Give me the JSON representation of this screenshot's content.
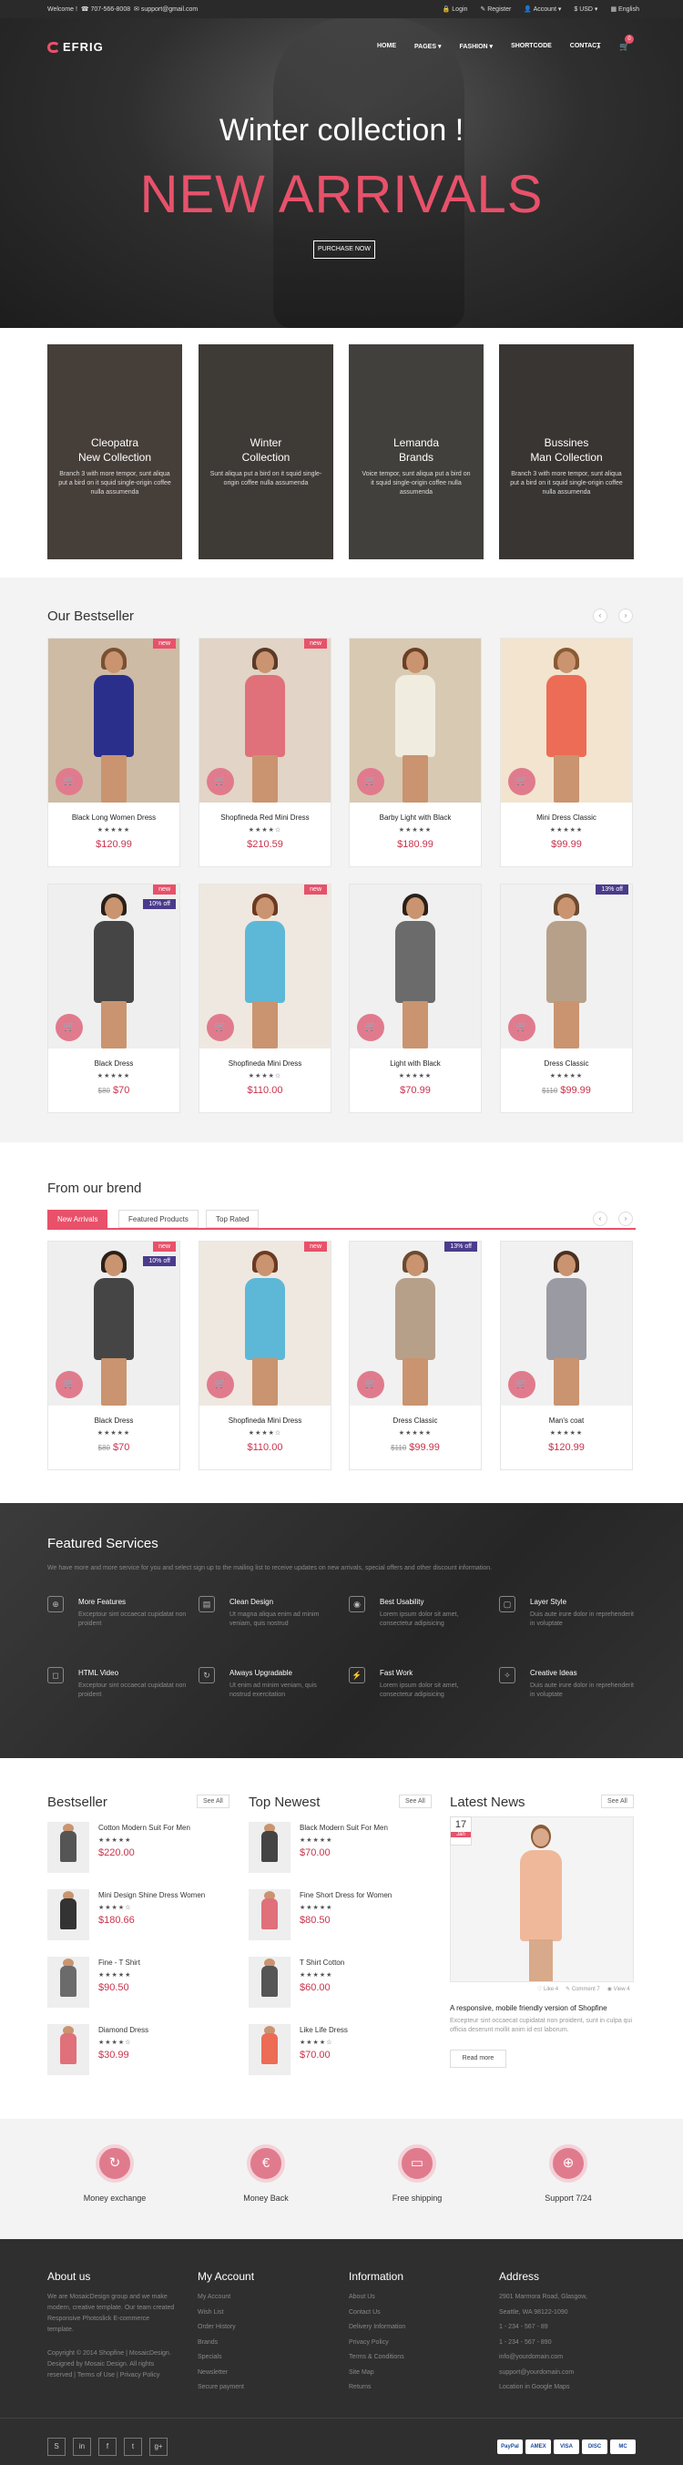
{
  "topbar": {
    "welcome": "Welcome !",
    "phone": "707-566-8008",
    "email": "support@gmail.com",
    "login": "Login",
    "register": "Register",
    "account": "Account",
    "currency": "$ USD",
    "language": "English"
  },
  "header": {
    "logo": "EFRIG",
    "menu": [
      "HOME",
      "PAGES",
      "FASHION",
      "SHORTCODE",
      "CONTACT"
    ],
    "cart_count": "0"
  },
  "hero": {
    "subtitle": "Winter collection !",
    "title": "NEW ARRIVALS",
    "button": "PURCHASE NOW"
  },
  "categories": [
    {
      "title_1": "Cleopatra",
      "title_2": "New Collection",
      "desc": "Branch 3 with more tempor, sunt aliqua put a bird on it squid single-origin coffee nulla assumenda",
      "bg": "#6b5a4e"
    },
    {
      "title_1": "Winter",
      "title_2": "Collection",
      "desc": "Sunt aliqua put a bird on it squid single-origin coffee nulla assumenda",
      "bg": "#5a5148"
    },
    {
      "title_1": "Lemanda",
      "title_2": "Brands",
      "desc": "Voice tempor, sunt aliqua put a bird on it squid single-origin coffee nulla assumenda",
      "bg": "#615e58"
    },
    {
      "title_1": "Bussines",
      "title_2": "Man Collection",
      "desc": "Branch 3 with more tempor, sunt aliqua put a bird on it squid single-origin coffee nulla assumenda",
      "bg": "#4c4540"
    }
  ],
  "bestseller": {
    "title": "Our Bestseller",
    "products": [
      {
        "name": "Black Long Women Dress",
        "stars": "★★★★★",
        "price": "$120.99",
        "old": "",
        "badge": "new",
        "badge_color": "#e8516a",
        "bg": "#cdbba5",
        "dress": "#2b2f8c",
        "hair": "#7a5030"
      },
      {
        "name": "Shopfineda Red Mini Dress",
        "stars": "★★★★☆",
        "price": "$210.59",
        "old": "",
        "badge": "new",
        "badge_color": "#e8516a",
        "bg": "#e2d4c6",
        "dress": "#e0707a",
        "hair": "#5a3a28"
      },
      {
        "name": "Barby Light with Black",
        "stars": "★★★★★",
        "price": "$180.99",
        "old": "",
        "badge": "",
        "badge_color": "",
        "bg": "#d8c9b3",
        "dress": "#f1ece0",
        "hair": "#6b3f25"
      },
      {
        "name": "Mini Dress Classic",
        "stars": "★★★★★",
        "price": "$99.99",
        "old": "",
        "badge": "",
        "badge_color": "",
        "bg": "#f2e4cf",
        "dress": "#ec6c55",
        "hair": "#8a5a35"
      },
      {
        "name": "Black Dress",
        "stars": "★★★★★",
        "price": "$70",
        "old": "$80",
        "badge": "10% off",
        "badge_color": "#4a3b8c",
        "badge2": "new",
        "bg": "#efefef",
        "dress": "#454545",
        "hair": "#2b2018"
      },
      {
        "name": "Shopfineda Mini Dress",
        "stars": "★★★★☆",
        "price": "$110.00",
        "old": "",
        "badge": "new",
        "badge_color": "#e8516a",
        "bg": "#efe8e0",
        "dress": "#5db8d8",
        "hair": "#6b3a22"
      },
      {
        "name": "Light with Black",
        "stars": "★★★★★",
        "price": "$70.99",
        "old": "",
        "badge": "",
        "badge_color": "",
        "bg": "#f0f0f0",
        "dress": "#6b6b6b",
        "hair": "#2b2018"
      },
      {
        "name": "Dress Classic",
        "stars": "★★★★★",
        "price": "$99.99",
        "old": "$110",
        "badge": "13% off",
        "badge_color": "#4a3b8c",
        "bg": "#f1f1f1",
        "dress": "#b7a08a",
        "hair": "#6b4a30"
      }
    ]
  },
  "brand": {
    "title": "From our brend",
    "tabs": [
      "New Arrivals",
      "Featured Products",
      "Top Rated"
    ],
    "products": [
      {
        "name": "Black Dress",
        "stars": "★★★★★",
        "price": "$70",
        "old": "$80",
        "badge": "10% off",
        "badge_color": "#4a3b8c",
        "badge2": "new",
        "bg": "#efefef",
        "dress": "#454545",
        "hair": "#2b2018"
      },
      {
        "name": "Shopfineda Mini Dress",
        "stars": "★★★★☆",
        "price": "$110.00",
        "old": "",
        "badge": "new",
        "badge_color": "#e8516a",
        "bg": "#efe8e0",
        "dress": "#5db8d8",
        "hair": "#6b3a22"
      },
      {
        "name": "Dress Classic",
        "stars": "★★★★★",
        "price": "$99.99",
        "old": "$110",
        "badge": "13% off",
        "badge_color": "#4a3b8c",
        "bg": "#f1f1f1",
        "dress": "#b7a08a",
        "hair": "#6b4a30"
      },
      {
        "name": "Man's coat",
        "stars": "★★★★★",
        "price": "$120.99",
        "old": "",
        "badge": "",
        "badge_color": "",
        "bg": "#f1f1f1",
        "dress": "#9a9aa2",
        "hair": "#4a3020"
      }
    ]
  },
  "services": {
    "title": "Featured Services",
    "intro": "We have more and more service for you and select sign up to the mailing list to receive updates on new arrivals, special offers and other discount information.",
    "items": [
      {
        "icon": "⊕",
        "title": "More Features",
        "desc": "Exceptour sint occaecat cupidatat non proident"
      },
      {
        "icon": "▤",
        "title": "Clean Design",
        "desc": "Ut magna aliqua enim ad minim veniam, quis nostrud"
      },
      {
        "icon": "◉",
        "title": "Best Usability",
        "desc": "Lorem ipsum dolor sit amet, consectetur adipisicing"
      },
      {
        "icon": "▢",
        "title": "Layer Style",
        "desc": "Duis aute irure dolor in reprehenderit in voluptate"
      },
      {
        "icon": "◻",
        "title": "HTML Video",
        "desc": "Exceptour sint occaecat cupidatat non proident"
      },
      {
        "icon": "↻",
        "title": "Always Upgradable",
        "desc": "Ut enim ad minim veniam, quis nostrud exercitation"
      },
      {
        "icon": "⚡",
        "title": "Fast Work",
        "desc": "Lorem ipsum dolor sit amet, consectetur adipisicing"
      },
      {
        "icon": "✧",
        "title": "Creative Ideas",
        "desc": "Duis aute irure dolor in reprehenderit in voluptate"
      }
    ]
  },
  "lists": {
    "see_all": "See All",
    "bestseller_title": "Bestseller",
    "newest_title": "Top Newest",
    "news_title": "Latest News",
    "bestseller": [
      {
        "name": "Cotton Modern Suit For Men",
        "stars": "★★★★★",
        "price": "$220.00",
        "old": "",
        "color": "#555"
      },
      {
        "name": "Mini Design Shine Dress Women",
        "stars": "★★★★☆",
        "price": "$180.66",
        "old": "",
        "color": "#333"
      },
      {
        "name": "Fine - T Shirt",
        "stars": "★★★★★",
        "price": "$90.50",
        "old": "",
        "color": "#6b6b6b"
      },
      {
        "name": "Diamond Dress",
        "stars": "★★★★☆",
        "price": "$30.99",
        "old": "",
        "color": "#e0707a"
      }
    ],
    "newest": [
      {
        "name": "Black Modern Suit For Men",
        "stars": "★★★★★",
        "price": "$70.00",
        "old": "",
        "color": "#444"
      },
      {
        "name": "Fine Short Dress for Women",
        "stars": "★★★★★",
        "price": "$80.50",
        "old": "",
        "color": "#e0707a"
      },
      {
        "name": "T Shirt Cotton",
        "stars": "★★★★★",
        "price": "$60.00",
        "old": "",
        "color": "#555"
      },
      {
        "name": "Like Life Dress",
        "stars": "★★★★☆",
        "price": "$70.00",
        "old": "",
        "color": "#ec6c55"
      }
    ],
    "news": {
      "day": "17",
      "month": "Jan",
      "likes": "♡ Like 4",
      "comments": "✎ Comment 7",
      "views": "◉ View 4",
      "title": "A responsive, mobile friendly version of Shopfine",
      "text": "Excepteur sint occaecat cupidatat non proident, sunt in culpa qui officia deserunt mollit anim id est laborum.",
      "button": "Read more"
    }
  },
  "policies": [
    {
      "icon": "↻",
      "label": "Money exchange"
    },
    {
      "icon": "€",
      "label": "Money Back"
    },
    {
      "icon": "▭",
      "label": "Free shipping"
    },
    {
      "icon": "⊕",
      "label": "Support 7/24"
    }
  ],
  "footer": {
    "about_title": "About us",
    "about_text": "We are MosaicDesign group and we make modern, creative template. Our team created Responsive Photoslick E-commerce template.",
    "copyright": "Copyright © 2014 Shopfine | MosaicDesign. Designed by Mosaic Design. All rights reserved | Terms of Use | Privacy Policy",
    "account_title": "My Account",
    "account_links": [
      "My Account",
      "Wish List",
      "Order History",
      "Brands",
      "Specials",
      "Newsletter",
      "Secure payment"
    ],
    "info_title": "Information",
    "info_links": [
      "About Us",
      "Contact Us",
      "Delivery Information",
      "Privacy Policy",
      "Terms & Conditions",
      "Site Map",
      "Returns"
    ],
    "address_title": "Address",
    "address_lines": [
      "2901 Marmora Road, Glasgow,",
      "Seattle, WA 98122-1090",
      "1 - 234 - 567 - 89",
      "1 - 234 - 567 - 890",
      "info@yourdomain.com",
      "support@yourdomain.com",
      "Location in Google Maps"
    ],
    "social": [
      "S",
      "in",
      "f",
      "t",
      "g+"
    ],
    "payments": [
      "PayPal",
      "AMEX",
      "VISA",
      "DISC",
      "MC"
    ]
  }
}
